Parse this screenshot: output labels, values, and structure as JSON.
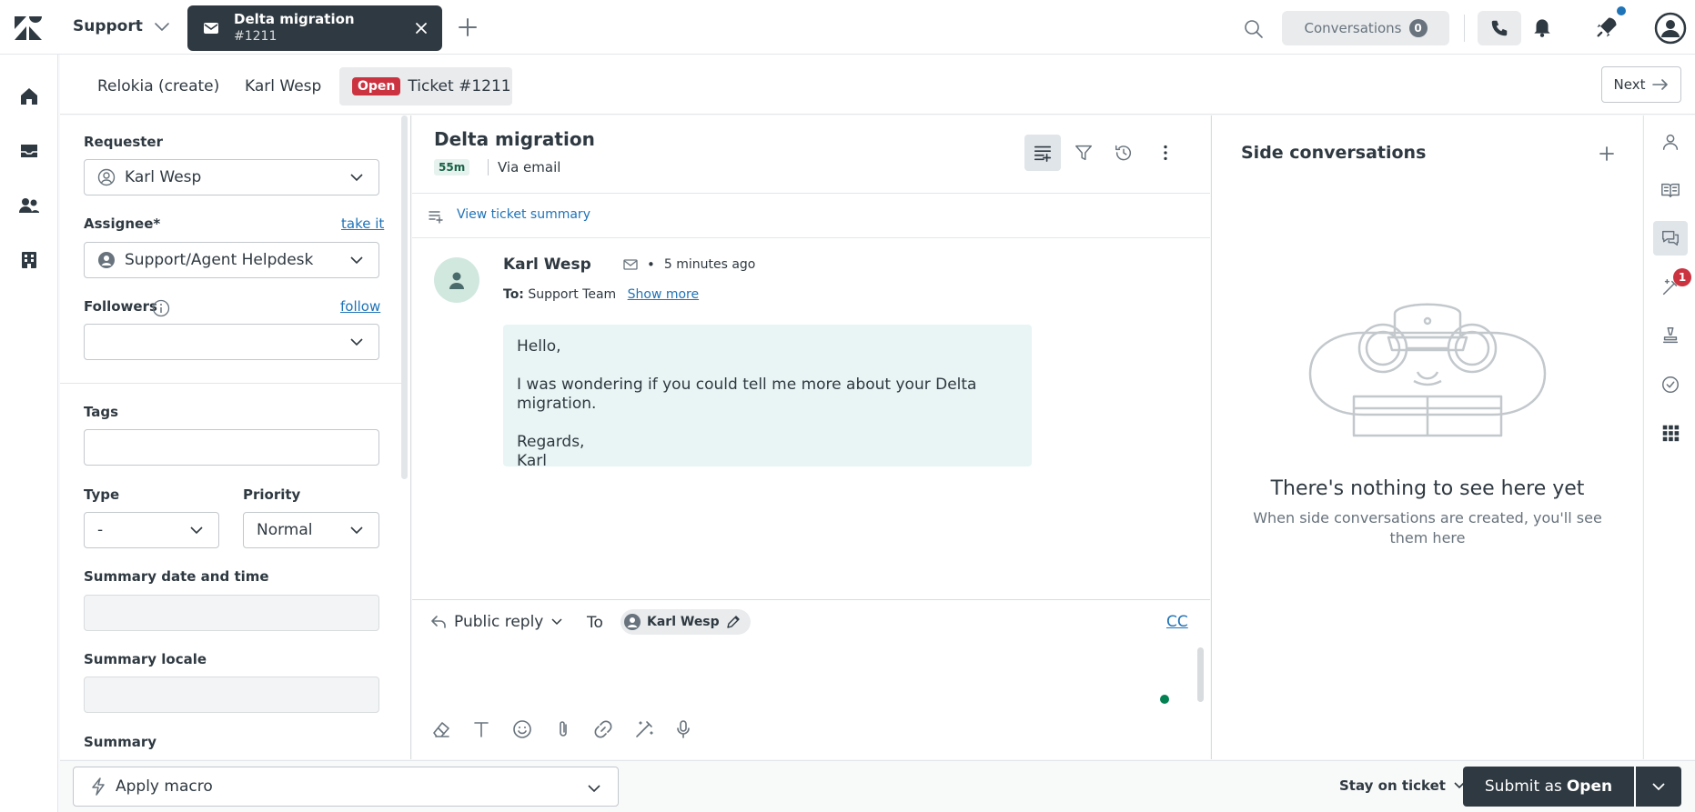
{
  "app": {
    "product": "Support",
    "active_tab": {
      "title": "Delta migration",
      "subtitle": "#1211"
    },
    "conversations_label": "Conversations",
    "conversations_count": "0"
  },
  "context_tabs": {
    "org": "Relokia (create)",
    "user": "Karl Wesp",
    "status": "Open",
    "ticket": "Ticket #1211",
    "next_label": "Next"
  },
  "properties": {
    "requester_label": "Requester",
    "requester_value": "Karl Wesp",
    "assignee_label": "Assignee*",
    "assignee_link": "take it",
    "assignee_value": "Support/Agent Helpdesk",
    "followers_label": "Followers",
    "followers_link": "follow",
    "tags_label": "Tags",
    "type_label": "Type",
    "type_value": "-",
    "priority_label": "Priority",
    "priority_value": "Normal",
    "summary_dt_label": "Summary date and time",
    "summary_locale_label": "Summary locale",
    "summary_label": "Summary"
  },
  "ticket": {
    "subject": "Delta migration",
    "age": "55m",
    "channel": "Via email",
    "summary_link": "View ticket summary"
  },
  "message": {
    "author": "Karl Wesp",
    "time": "5 minutes ago",
    "to_prefix": "To:",
    "to_value": "Support Team",
    "show_more": "Show more",
    "lines": [
      "Hello,",
      "I was wondering if you could tell me more about your Delta migration.",
      "Regards,",
      "Karl"
    ]
  },
  "composer": {
    "reply_type": "Public reply",
    "to_label": "To",
    "recipient": "Karl Wesp",
    "cc": "CC"
  },
  "side_conversations": {
    "title": "Side conversations",
    "empty_title": "There's nothing to see here yet",
    "empty_subtitle": "When side conversations are created, you'll see them here"
  },
  "rail": {
    "badge_count": "1"
  },
  "footer": {
    "macro_placeholder": "Apply macro",
    "stay_label": "Stay on ticket",
    "submit_prefix": "Submit as",
    "submit_status": "Open"
  },
  "colors": {
    "brand_dark": "#2f3941",
    "link": "#1f73b7",
    "open_status": "#cc3340",
    "message_bg": "#e8f5f4",
    "presence": "#038153"
  }
}
